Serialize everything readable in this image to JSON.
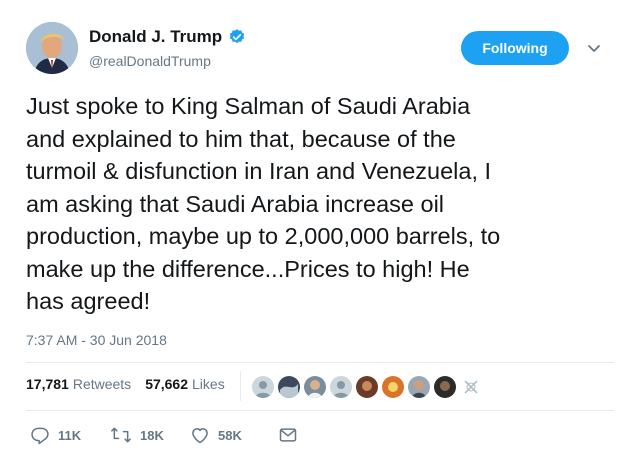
{
  "user": {
    "display_name": "Donald J. Trump",
    "handle": "@realDonaldTrump",
    "verified_icon": "verified-badge-icon",
    "avatar_icon": "profile-avatar"
  },
  "follow_button": {
    "label": "Following",
    "color": "#1da1f2"
  },
  "menu_icon": "chevron-down-icon",
  "tweet": {
    "lines": [
      "Just spoke to King Salman of Saudi Arabia",
      "and explained to him that, because of the",
      "turmoil & disfunction in Iran and Venezuela, I",
      "am asking that Saudi Arabia increase oil",
      "production, maybe up to 2,000,000 barrels, to",
      "make up the difference...Prices to high! He",
      "has agreed!"
    ],
    "timestamp": "7:37 AM - 30 Jun 2018"
  },
  "stats": {
    "retweets_count": "17,781",
    "retweets_label": "Retweets",
    "likes_count": "57,662",
    "likes_label": "Likes",
    "liker_avatars": [
      "liker-1",
      "liker-2",
      "liker-3",
      "liker-4",
      "liker-5",
      "liker-6",
      "liker-7",
      "liker-8",
      "liker-9",
      "liker-10"
    ]
  },
  "actions": {
    "reply_count": "11K",
    "retweet_count": "18K",
    "like_count": "58K",
    "icons": [
      "reply-icon",
      "retweet-icon",
      "heart-icon",
      "direct-message-icon"
    ]
  },
  "colors": {
    "text": "#14171a",
    "secondary": "#657786",
    "accent": "#1da1f2",
    "divider": "#e6ecf0"
  }
}
